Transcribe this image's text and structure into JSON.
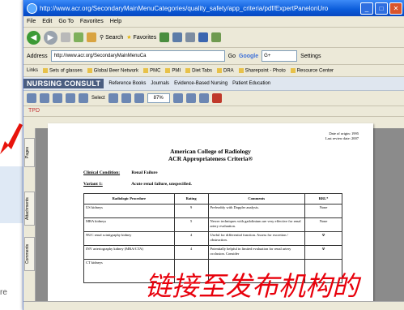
{
  "window": {
    "title": "http://www.acr.org/SecondaryMainMenuCategories/quality_safety/app_criteria/pdf/ExpertPanelonUro",
    "minimize": "_",
    "maximize": "□",
    "close": "✕"
  },
  "menu": [
    "File",
    "Edit",
    "Go To",
    "Favorites",
    "Help"
  ],
  "nav": {
    "back": "◀",
    "forward": "▶",
    "search": "Search",
    "favorites": "Favorites"
  },
  "address": {
    "label": "Address",
    "url": "http://www.acr.org/SecondaryMainMenuCa",
    "go": "Go",
    "google": "Google",
    "google_value": "G+",
    "settings": "Settings"
  },
  "links": [
    "Links",
    "Sets of glasses",
    "Global Beer Network",
    "PMC",
    "PMI",
    "Diet Tabs",
    "DRA",
    "Sharepoint - Photo",
    "Resource Center"
  ],
  "nursing_bar": {
    "logo": "NURSING CONSULT",
    "items": [
      "Reference Books",
      "Journals",
      "Evidence-Based Nursing",
      "Patient Education"
    ]
  },
  "pdf_toolbar": {
    "select": "Select",
    "zoom": "87%"
  },
  "tab": "TPD",
  "sidebar_tabs": [
    "Pages",
    "Attachments",
    "Comments"
  ],
  "document": {
    "date_line1": "Date of origin: 1995",
    "date_line2": "Last review date: 2007",
    "title_line1": "American College of Radiology",
    "title_line2": "ACR Appropriateness Criteria®",
    "condition_label": "Clinical Condition:",
    "condition_value": "Renal Failure",
    "variant_label": "Variant 1:",
    "variant_value": "Acute renal failure, unspecified.",
    "table": {
      "headers": [
        "Radiologic Procedure",
        "Rating",
        "Comments",
        "RRL*"
      ],
      "rows": [
        {
          "procedure": "US kidneys",
          "rating": "9",
          "comment": "Preferably with Doppler analysis.",
          "rrl": "None"
        },
        {
          "procedure": "MRA kidneys",
          "rating": "5",
          "comment": "Newer techniques with gadolinium are very effective for renal artery evaluation.",
          "rrl": "None"
        },
        {
          "procedure": "NUC renal scintigraphy kidney",
          "rating": "4",
          "comment": "Useful for differential function. Assess for excretion / obstruction.",
          "rrl": "☢"
        },
        {
          "procedure": "INV arteriography kidney (MRA/CTA)",
          "rating": "4",
          "comment": "Potentially helpful in limited evaluation for renal artery occlusion. Consider",
          "rrl": "☢"
        },
        {
          "procedure": "CT kidneys",
          "rating": "",
          "comment": "",
          "rrl": ""
        }
      ]
    }
  },
  "background_text": "re",
  "overlay_text": "链接至发布机构的"
}
